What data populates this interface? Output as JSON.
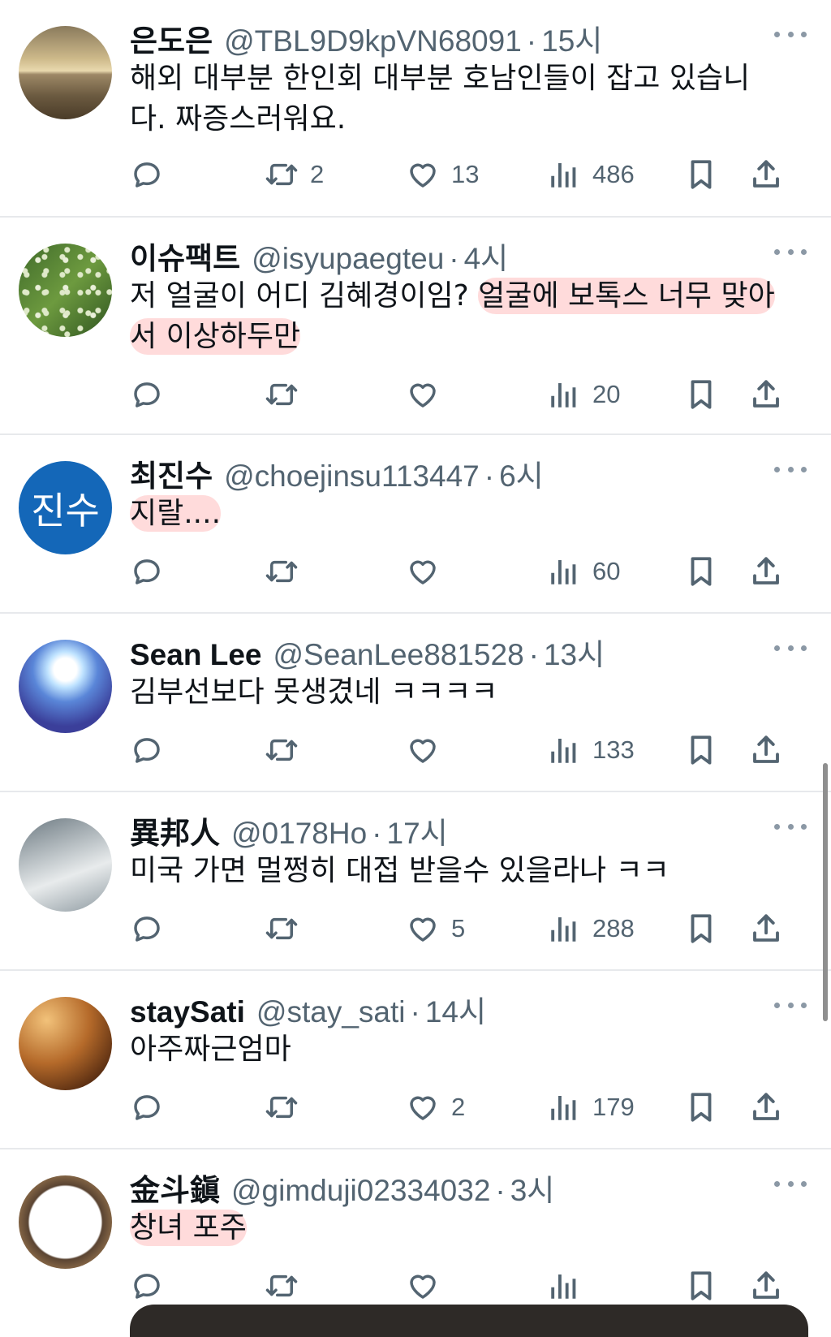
{
  "tweets": [
    {
      "name": "은도은",
      "handle": "@TBL9D9kpVN68091",
      "time": "15시",
      "text_plain": "해외 대부분 한인회 대부분 호남인들이 잡고 있습니다. 짜증스러워요.",
      "text_highlight": "",
      "reply": "",
      "retweet": "2",
      "like": "13",
      "views": "486"
    },
    {
      "name": "이슈팩트",
      "handle": "@isyupaegteu",
      "time": "4시",
      "text_plain": "저 얼굴이 어디 김혜경이임? ",
      "text_highlight": "얼굴에 보톡스 너무 맞아서 이상하두만",
      "reply": "",
      "retweet": "",
      "like": "",
      "views": "20"
    },
    {
      "name": "최진수",
      "handle": "@choejinsu113447",
      "time": "6시",
      "text_plain": "",
      "text_highlight": "지랄....",
      "avatar_text": "진수",
      "reply": "",
      "retweet": "",
      "like": "",
      "views": "60"
    },
    {
      "name": "Sean Lee",
      "handle": "@SeanLee881528",
      "time": "13시",
      "text_plain": "김부선보다 못생겼네 ㅋㅋㅋㅋ",
      "text_highlight": "",
      "reply": "",
      "retweet": "",
      "like": "",
      "views": "133"
    },
    {
      "name": "異邦人",
      "handle": "@0178Ho",
      "time": "17시",
      "text_plain": "미국 가면 멀쩡히 대접 받을수 있을라나 ㅋㅋ",
      "text_highlight": "",
      "reply": "",
      "retweet": "",
      "like": "5",
      "views": "288"
    },
    {
      "name": "staySati",
      "handle": "@stay_sati",
      "time": "14시",
      "text_plain": "아주짜근엄마",
      "text_highlight": "",
      "reply": "",
      "retweet": "",
      "like": "2",
      "views": "179"
    },
    {
      "name": "金斗鎭",
      "handle": "@gimduji02334032",
      "time": "3시",
      "text_plain": "",
      "text_highlight": "창녀 포주",
      "reply": "",
      "retweet": "",
      "like": "",
      "views": ""
    }
  ],
  "dot": "·",
  "colors": {
    "accent": "#1d9bf0",
    "muted": "#536471",
    "highlight": "#ffbebe"
  },
  "icons": {
    "reply": "reply-icon",
    "retweet": "retweet-icon",
    "like": "heart-icon",
    "views": "views-icon",
    "bookmark": "bookmark-icon",
    "share": "share-icon",
    "more": "more-icon"
  }
}
